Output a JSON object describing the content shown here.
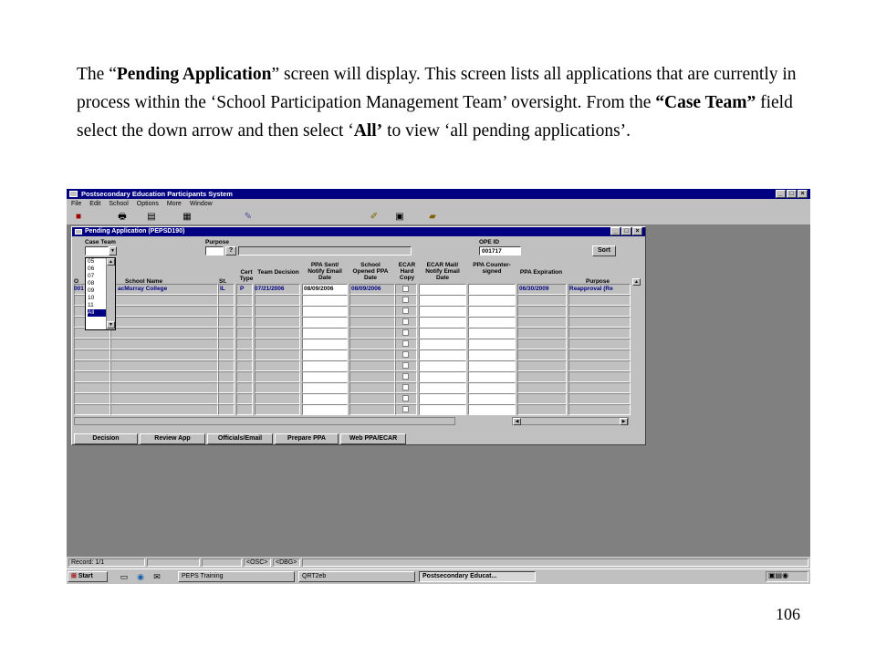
{
  "slide": {
    "p1": "The “",
    "b1": "Pending Application",
    "p2": "” screen will display.  This screen lists all applications that are currently in process within the ‘School Participation Management Team’ oversight.  From the ",
    "b2": "“Case Team”",
    "p3": " field select the down arrow and then select ‘",
    "b3": "All’",
    "p4": " to view ‘all pending applications’.",
    "page_number": "106"
  },
  "app": {
    "title": "Postsecondary Education Participants System",
    "menu": [
      "File",
      "Edit",
      "School",
      "Options",
      "More",
      "Window"
    ],
    "win_min": "_",
    "win_max": "□",
    "win_close": "×"
  },
  "child": {
    "title": "Pending Application (PEPSD190)",
    "case_team_label": "Case Team",
    "purpose_label": "Purpose",
    "ope_id_label": "OPE ID",
    "ope_id_value": "001717",
    "sort_button": "Sort",
    "lookup_icon": "?",
    "headers": {
      "o": "O",
      "school_name": "School Name",
      "st": "St.",
      "cert_type": "Cert Type",
      "team_decision": "Team Decision",
      "ppa_sent": "PPA Sent/ Notify Email Date",
      "school_opened": "School Opened PPA Date",
      "ecar_hard": "ECAR Hard Copy",
      "ecar_mail": "ECAR Mail/ Notify Email Date",
      "ppa_counter": "PPA Counter- signed",
      "ppa_expiration": "PPA Expiration",
      "purpose": "Purpose"
    },
    "row1": {
      "o": "001",
      "school_name": "acMurray College",
      "st": "IL",
      "cert_type": "P",
      "team_decision": "07/21/2006",
      "ppa_sent": "08/09/2006",
      "school_opened": "08/09/2006",
      "ppa_expiration": "06/30/2009",
      "purpose": "Reapproval (Re"
    },
    "dropdown_options": [
      "05",
      "06",
      "07",
      "08",
      "09",
      "10",
      "11",
      "All"
    ],
    "buttons": [
      "Decision",
      "Review App",
      "Officials/Email",
      "Prepare PPA",
      "Web PPA/ECAR"
    ]
  },
  "status": {
    "record": "Record: 1/1",
    "osc": "<OSC>",
    "dbg": "<DBG>"
  },
  "taskbar": {
    "start": "Start",
    "items": [
      "PEPS Training",
      "QRT2eb",
      "Postsecondary Educat..."
    ]
  }
}
